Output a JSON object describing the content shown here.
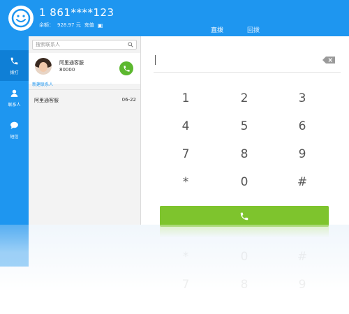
{
  "header": {
    "phone_number": "1 861****123",
    "balance_label": "余额：",
    "balance_value": "928.97 元",
    "recharge_label": "充值"
  },
  "tabs": [
    {
      "label": "直拨",
      "active": true
    },
    {
      "label": "回拨",
      "active": false
    }
  ],
  "nav": [
    {
      "label": "拨打",
      "icon": "phone-icon"
    },
    {
      "label": "联系人",
      "icon": "person-icon"
    },
    {
      "label": "短信",
      "icon": "chat-icon"
    }
  ],
  "search": {
    "placeholder": "搜索联系人"
  },
  "contact": {
    "name": "阿里通客服",
    "number": "80000"
  },
  "add_contact_label": "新建联系人",
  "recent": {
    "name": "阿里通客服",
    "date": "06-22"
  },
  "keypad": [
    "1",
    "2",
    "3",
    "4",
    "5",
    "6",
    "7",
    "8",
    "9",
    "*",
    "0",
    "#"
  ],
  "colors": {
    "brand_blue": "#1e96f0",
    "call_green": "#7ec42d",
    "contact_call_green": "#5cb82f"
  }
}
